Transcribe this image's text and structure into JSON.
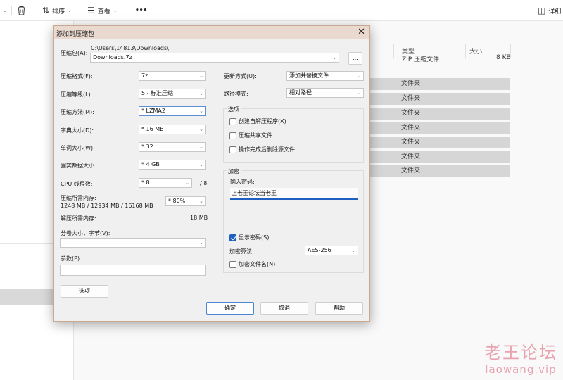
{
  "toolbar": {
    "sort_label": "排序",
    "view_label": "查看",
    "more_label": "•••",
    "details_label": "详细"
  },
  "list": {
    "col_type": "类型",
    "col_size": "大小",
    "file_type": "ZIP 压缩文件",
    "file_size": "8 KB",
    "folder_rows": [
      "文件夹",
      "文件夹",
      "文件夹",
      "文件夹",
      "文件夹",
      "文件夹",
      "文件夹"
    ]
  },
  "watermark": {
    "cn": "老王论坛",
    "en": "laowang.vip"
  },
  "dialog": {
    "title": "添加到压缩包",
    "close": "✕",
    "archive_label": "压缩包(A):",
    "archive_path": "C:\\Users\\14813\\Downloads\\",
    "archive_name": "Downloads.7z",
    "browse": "...",
    "format_label": "压缩格式(F):",
    "format_value": "7z",
    "level_label": "压缩等级(L):",
    "level_value": "5 - 标准压缩",
    "method_label": "压缩方法(M):",
    "method_value": "* LZMA2",
    "dict_label": "字典大小(D):",
    "dict_value": "* 16 MB",
    "word_label": "单词大小(W):",
    "word_value": "* 32",
    "solid_label": "固实数据大小:",
    "solid_value": "* 4 GB",
    "cpu_label": "CPU 线程数:",
    "cpu_value": "* 8",
    "cpu_total": "/ 8",
    "mem_label": "压缩所需内存:",
    "mem_detail": "1248 MB / 12934 MB / 16168 MB",
    "mem_percent": "* 80%",
    "decomp_label": "解压所需内存:",
    "decomp_value": "18 MB",
    "split_label": "分卷大小，字节(V):",
    "split_value": "",
    "params_label": "参数(P):",
    "params_value": "",
    "options_button": "选项",
    "update_label": "更新方式(U):",
    "update_value": "添加并替换文件",
    "pathmode_label": "路径模式:",
    "pathmode_value": "相对路径",
    "options_group": "选项",
    "opt_sfx": "创建自解压程序(X)",
    "opt_shared": "压缩共享文件",
    "opt_delete": "操作完成后删除源文件",
    "encrypt_group": "加密",
    "pw_label": "输入密码:",
    "pw_value": "上老王论坛当老王",
    "show_pw": "显示密码(S)",
    "enc_method_label": "加密算法:",
    "enc_method_value": "AES-256",
    "enc_names": "加密文件名(N)",
    "ok": "确定",
    "cancel": "取消",
    "help": "帮助"
  }
}
